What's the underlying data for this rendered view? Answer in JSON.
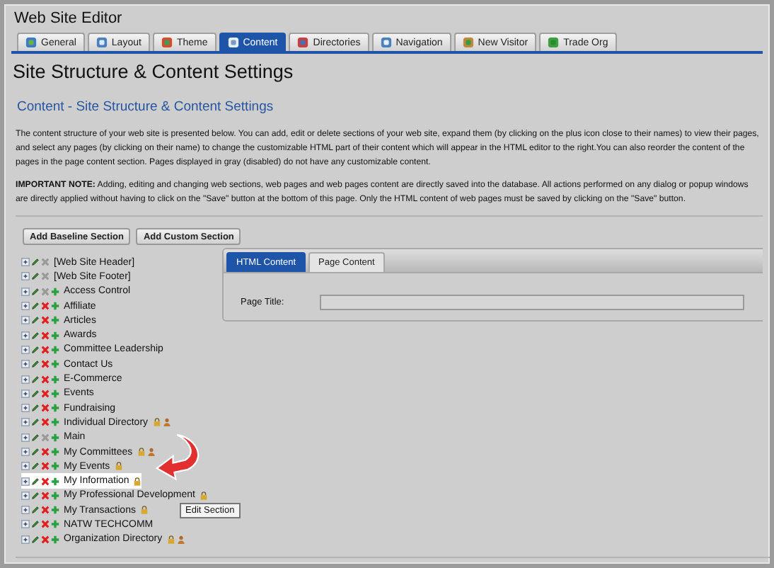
{
  "window": {
    "title": "Web Site Editor"
  },
  "tabs": [
    {
      "label": "General",
      "selected": false
    },
    {
      "label": "Layout",
      "selected": false
    },
    {
      "label": "Theme",
      "selected": false
    },
    {
      "label": "Content",
      "selected": true
    },
    {
      "label": "Directories",
      "selected": false
    },
    {
      "label": "Navigation",
      "selected": false
    },
    {
      "label": "New Visitor",
      "selected": false
    },
    {
      "label": "Trade Org",
      "selected": false
    }
  ],
  "page": {
    "heading": "Site Structure & Content Settings",
    "subheading": "Content - Site Structure & Content Settings",
    "intro": "The content structure of your web site is presented below. You can add, edit or delete sections of your web site, expand them (by clicking on the plus icon close to their names) to view their pages, and select any pages (by clicking on their name) to change the customizable HTML part of their content which will appear in the HTML editor to the right.You can also reorder the content of the pages in the page content section. Pages displayed in gray (disabled) do not have any customizable content.",
    "note": "**IMPORTANT NOTE:** Adding, editing and changing web sections, web pages and web pages content are directly saved into the database. All actions performed on any dialog or popup windows are directly applied without having to click on the \"Save\" button at the bottom of this page. Only the HTML content of web pages must be saved by clicking on the \"Save\" button."
  },
  "buttons": [
    "Add Baseline Section",
    "Add Custom Section"
  ],
  "tree": [
    {
      "label": "[Web Site Header]",
      "can_delete": false,
      "can_add": false,
      "locked": false,
      "person_badge": false,
      "selected": false
    },
    {
      "label": "[Web Site Footer]",
      "can_delete": false,
      "can_add": false,
      "locked": false,
      "person_badge": false,
      "selected": false
    },
    {
      "label": "Access Control",
      "can_delete": false,
      "can_add": true,
      "locked": false,
      "person_badge": false,
      "selected": false
    },
    {
      "label": "Affiliate",
      "can_delete": true,
      "can_add": true,
      "locked": false,
      "person_badge": false,
      "selected": false
    },
    {
      "label": "Articles",
      "can_delete": true,
      "can_add": true,
      "locked": false,
      "person_badge": false,
      "selected": false
    },
    {
      "label": "Awards",
      "can_delete": true,
      "can_add": true,
      "locked": false,
      "person_badge": false,
      "selected": false
    },
    {
      "label": "Committee Leadership",
      "can_delete": true,
      "can_add": true,
      "locked": false,
      "person_badge": false,
      "selected": false
    },
    {
      "label": "Contact Us",
      "can_delete": true,
      "can_add": true,
      "locked": false,
      "person_badge": false,
      "selected": false
    },
    {
      "label": "E-Commerce",
      "can_delete": true,
      "can_add": true,
      "locked": false,
      "person_badge": false,
      "selected": false
    },
    {
      "label": "Events",
      "can_delete": true,
      "can_add": true,
      "locked": false,
      "person_badge": false,
      "selected": false
    },
    {
      "label": "Fundraising",
      "can_delete": true,
      "can_add": true,
      "locked": false,
      "person_badge": false,
      "selected": false
    },
    {
      "label": "Individual Directory",
      "can_delete": true,
      "can_add": true,
      "locked": true,
      "person_badge": true,
      "selected": false
    },
    {
      "label": "Main",
      "can_delete": false,
      "can_add": true,
      "locked": false,
      "person_badge": false,
      "selected": false
    },
    {
      "label": "My Committees",
      "can_delete": true,
      "can_add": true,
      "locked": true,
      "person_badge": true,
      "selected": false
    },
    {
      "label": "My Events",
      "can_delete": true,
      "can_add": true,
      "locked": true,
      "person_badge": false,
      "selected": false
    },
    {
      "label": "My Information",
      "can_delete": true,
      "can_add": true,
      "locked": true,
      "person_badge": false,
      "selected": true
    },
    {
      "label": "My Professional Development",
      "can_delete": true,
      "can_add": true,
      "locked": true,
      "person_badge": false,
      "selected": false
    },
    {
      "label": "My Transactions",
      "can_delete": true,
      "can_add": true,
      "locked": true,
      "person_badge": false,
      "selected": false
    },
    {
      "label": "NATW TECHCOMM",
      "can_delete": true,
      "can_add": true,
      "locked": false,
      "person_badge": false,
      "selected": false
    },
    {
      "label": "Organization Directory",
      "can_delete": true,
      "can_add": true,
      "locked": true,
      "person_badge": true,
      "selected": false
    }
  ],
  "tooltip": "Edit Section",
  "editor": {
    "tabs": [
      {
        "label": "HTML Content",
        "selected": true
      },
      {
        "label": "Page Content",
        "selected": false
      }
    ],
    "field_label": "Page Title:"
  }
}
